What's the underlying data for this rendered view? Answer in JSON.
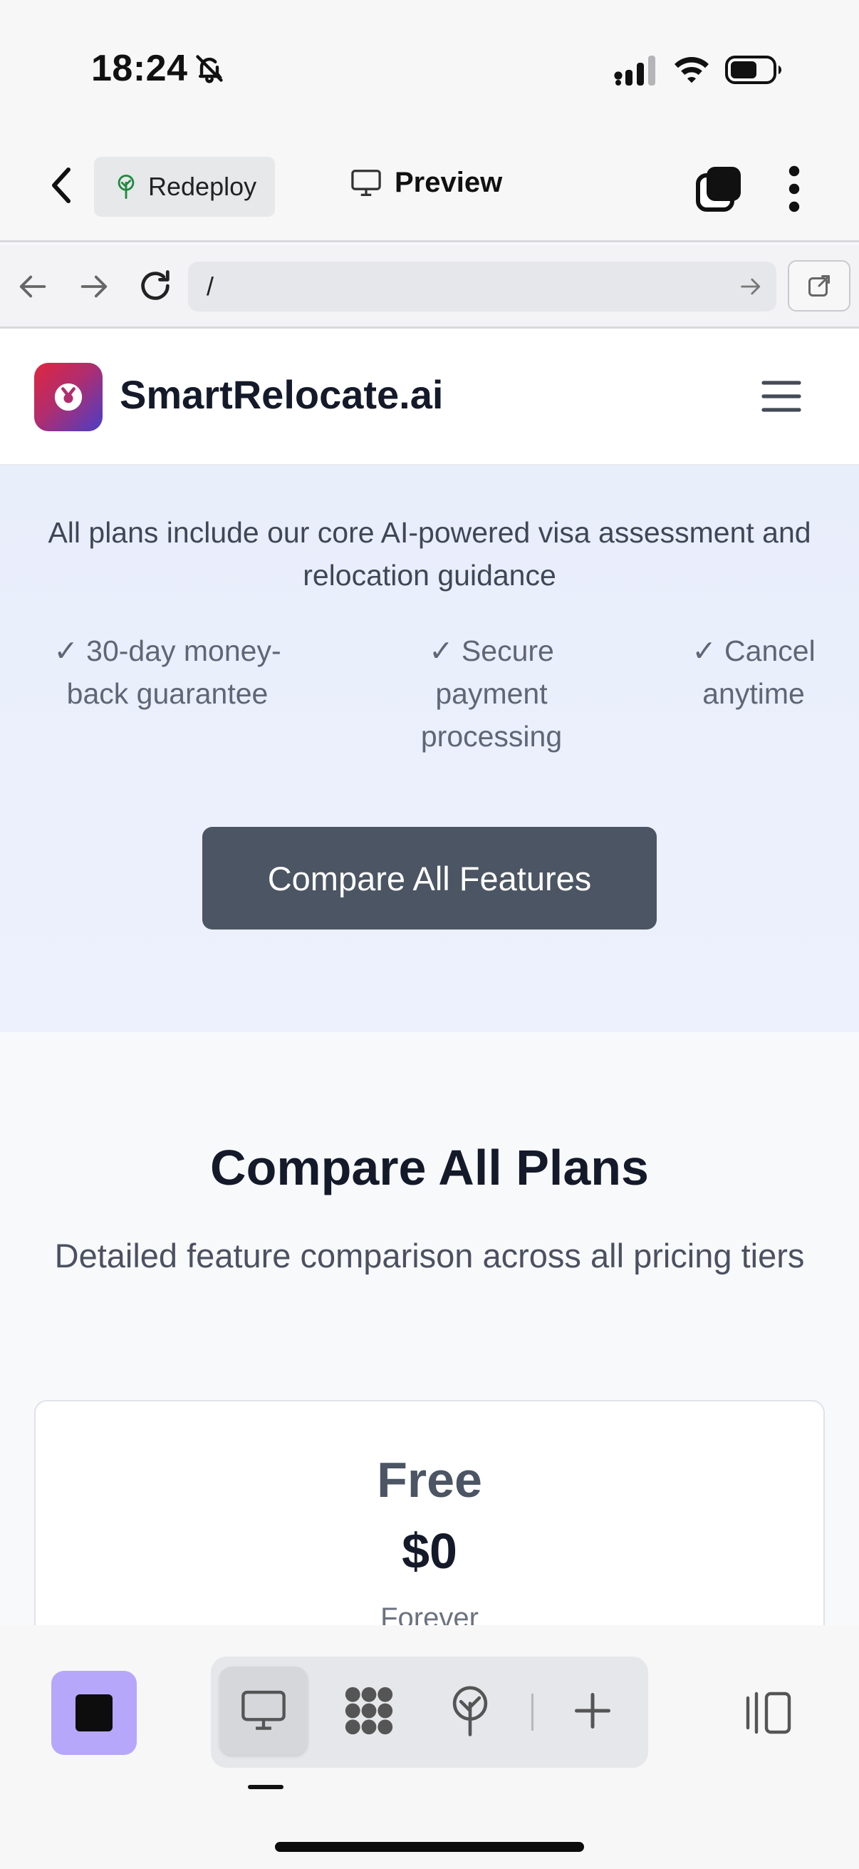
{
  "status": {
    "time": "18:24"
  },
  "toolbar": {
    "redeploy_label": "Redeploy",
    "preview_label": "Preview"
  },
  "browser": {
    "url": "/"
  },
  "site": {
    "brand": "SmartRelocate.ai"
  },
  "hero": {
    "note": "All plans include our core AI-powered visa assessment and relocation guidance",
    "perks": [
      "✓ 30-day money-back guarantee",
      "✓ Secure payment processing",
      "✓ Cancel anytime"
    ],
    "cta_label": "Compare All Features"
  },
  "compare": {
    "title": "Compare All Plans",
    "subtitle": "Detailed feature comparison across all pricing tiers",
    "plans": [
      {
        "name": "Free",
        "price": "$0",
        "period": "Forever"
      }
    ]
  },
  "colors": {
    "accent": "#b7a7fb",
    "cta": "#4b5563",
    "hero_bg": "#eceffc"
  },
  "icons": [
    "mute-bell-icon",
    "signal-icon",
    "wifi-icon",
    "battery-icon",
    "back-chevron-icon",
    "redeploy-tree-icon",
    "monitor-icon",
    "tabs-icon",
    "more-vertical-icon",
    "arrow-left-icon",
    "arrow-right-icon",
    "reload-icon",
    "external-link-icon",
    "hamburger-icon",
    "stop-icon",
    "grid-blob-icon",
    "deploy-icon",
    "plus-icon",
    "panel-icon"
  ]
}
